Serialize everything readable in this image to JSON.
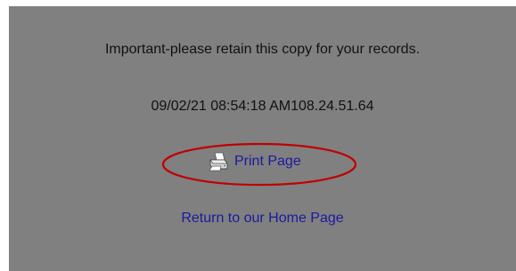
{
  "notice": {
    "text": "Important-please retain this copy for your records."
  },
  "stamp": {
    "text": "09/02/21 08:54:18 AM108.24.51.64"
  },
  "print": {
    "label": "Print Page",
    "icon": "printer-icon"
  },
  "home": {
    "label": "Return to our Home Page"
  },
  "colors": {
    "panel_background": "#808080",
    "link": "#1a1a9e",
    "text": "#111111",
    "annotation_circle": "#c00000"
  }
}
